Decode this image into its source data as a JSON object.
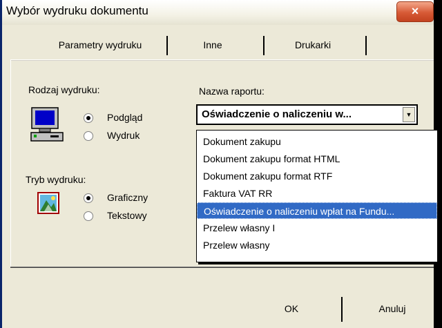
{
  "window": {
    "title": "Wybór wydruku dokumentu",
    "close_label": "×"
  },
  "tabs": [
    {
      "label": "Parametry wydruku"
    },
    {
      "label": "Inne"
    },
    {
      "label": "Drukarki"
    }
  ],
  "print_type": {
    "label": "Rodzaj wydruku:",
    "options": [
      {
        "label": "Podgląd",
        "selected": true
      },
      {
        "label": "Wydruk",
        "selected": false
      }
    ]
  },
  "print_mode": {
    "label": "Tryb wydruku:",
    "options": [
      {
        "label": "Graficzny",
        "selected": true
      },
      {
        "label": "Tekstowy",
        "selected": false
      }
    ]
  },
  "report": {
    "label": "Nazwa raportu:",
    "selected": "Oświadczenie o naliczeniu w...",
    "options": [
      "Dokument zakupu",
      "Dokument zakupu format HTML",
      "Dokument zakupu format RTF",
      "Faktura VAT RR",
      "Oświadczenie o naliczeniu wpłat na Fundu...",
      "Przelew własny I",
      "Przelew własny"
    ],
    "highlighted_index": 4
  },
  "buttons": {
    "ok": "OK",
    "cancel": "Anuluj"
  }
}
